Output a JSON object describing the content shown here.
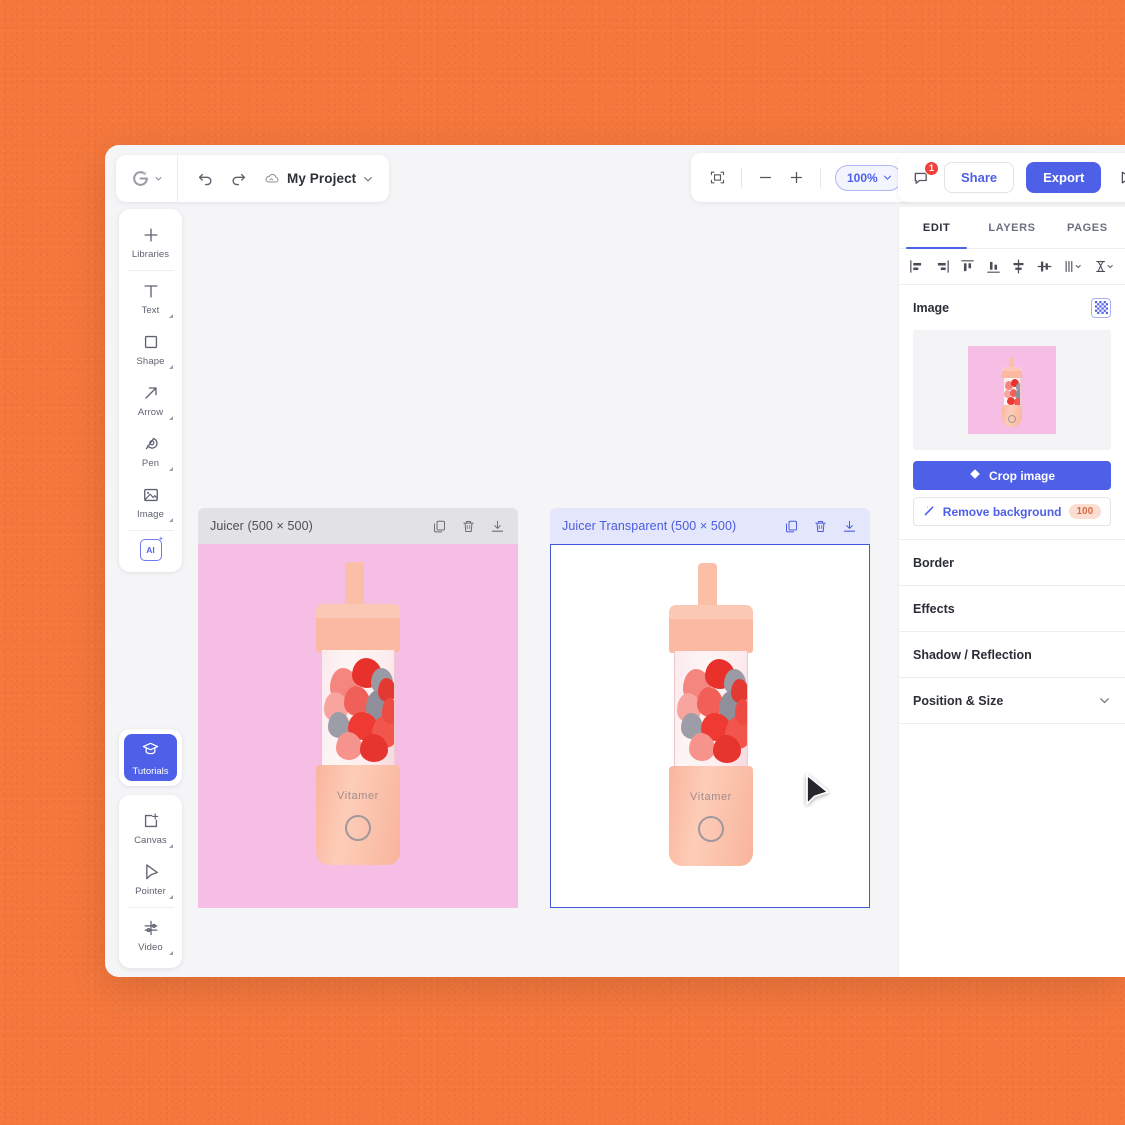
{
  "app": {
    "background_color": "#F5773C",
    "accent_color": "#4F60E8"
  },
  "topbar": {
    "brand_icon": "g-logo-icon",
    "brand_chevron": "chevron-down-icon",
    "undo_icon": "undo-icon",
    "redo_icon": "redo-icon",
    "project_icon": "cloud-icon",
    "project_name": "My Project",
    "project_chevron": "chevron-down-icon",
    "fit_icon": "fit-to-screen-icon",
    "zoom_out_icon": "minus-icon",
    "zoom_in_icon": "plus-icon",
    "zoom_value": "100%",
    "zoom_chevron": "chevron-down-icon",
    "comment_icon": "comment-icon",
    "comment_count": "1",
    "share_label": "Share",
    "export_label": "Export",
    "present_icon": "play-icon"
  },
  "left_toolbar": {
    "primary": [
      {
        "label": "Libraries",
        "icon": "plus-icon",
        "has_corner": false
      },
      {
        "label": "Text",
        "icon": "text-icon",
        "has_corner": true
      },
      {
        "label": "Shape",
        "icon": "square-icon",
        "has_corner": true
      },
      {
        "label": "Arrow",
        "icon": "arrow-icon",
        "has_corner": true
      },
      {
        "label": "Pen",
        "icon": "pen-icon",
        "has_corner": true
      },
      {
        "label": "Image",
        "icon": "image-icon",
        "has_corner": true
      }
    ],
    "ai_label": "AI",
    "tutorials": {
      "label": "Tutorials",
      "icon": "graduation-cap-icon"
    },
    "secondary": [
      {
        "label": "Canvas",
        "icon": "canvas-icon",
        "has_corner": true
      },
      {
        "label": "Pointer",
        "icon": "pointer-icon",
        "has_corner": true
      },
      {
        "label": "Video",
        "icon": "video-icon",
        "has_corner": true
      }
    ]
  },
  "canvas": {
    "artboards": [
      {
        "title": "Juicer (500 × 500)",
        "selected": false,
        "background": "#F7BEE5",
        "actions": [
          "duplicate-icon",
          "delete-icon",
          "download-icon"
        ],
        "product_label": "Vitamer"
      },
      {
        "title": "Juicer Transparent (500 × 500)",
        "selected": true,
        "background": "#FFFFFF",
        "actions": [
          "duplicate-icon",
          "delete-icon",
          "download-icon"
        ],
        "product_label": "Vitamer"
      }
    ]
  },
  "right_panel": {
    "tabs": [
      {
        "label": "EDIT",
        "active": true
      },
      {
        "label": "LAYERS",
        "active": false
      },
      {
        "label": "PAGES",
        "active": false
      }
    ],
    "align_icons": [
      "align-left-icon",
      "align-right-icon",
      "align-top-icon",
      "align-bottom-icon",
      "align-vertical-center-icon",
      "align-horizontal-center-icon",
      "distribute-horizontal-icon",
      "distribute-vertical-icon"
    ],
    "image_section": {
      "title": "Image",
      "transparency_icon": "checkerboard-icon",
      "crop_label": "Crop image",
      "crop_icon": "crop-diamond-icon",
      "remove_bg_label": "Remove background",
      "remove_bg_icon": "magic-wand-icon",
      "remove_bg_credits": "100"
    },
    "sections": [
      {
        "title": "Border",
        "chevron": false
      },
      {
        "title": "Effects",
        "chevron": false
      },
      {
        "title": "Shadow / Reflection",
        "chevron": false
      },
      {
        "title": "Position & Size",
        "chevron": true
      }
    ]
  },
  "cursor": {
    "icon": "mouse-pointer-icon"
  }
}
